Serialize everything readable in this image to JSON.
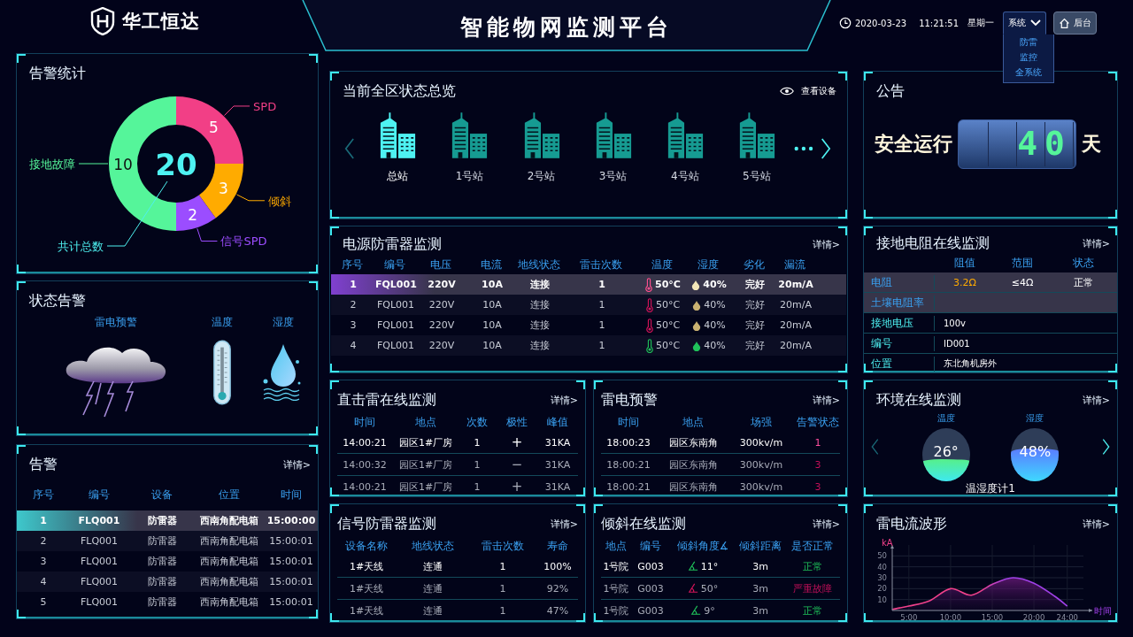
{
  "header": {
    "logo_text": "华工恒达",
    "title": "智能物网监测平台",
    "date": "2020-03-23",
    "time": "11:21:51",
    "weekday": "星期一",
    "system_menu": {
      "label": "系统",
      "expanded": true,
      "items": [
        "防雷",
        "监控",
        "全系统"
      ]
    },
    "back_button": "后台"
  },
  "alarm_stats": {
    "title": "告警统计",
    "total": "20",
    "total_label": "共计总数",
    "callouts": [
      {
        "color": "#f23f86"
      },
      {
        "color": "#ffab00"
      },
      {
        "color": "#9b4dff"
      },
      {
        "color": "#55f59a"
      }
    ],
    "chart_data": {
      "type": "donut",
      "categories": [
        "SPD",
        "倾斜",
        "信号SPD",
        "接地故障"
      ],
      "series": [
        {
          "values": [
            5,
            3,
            2,
            10
          ]
        }
      ],
      "data_labels": true
    }
  },
  "status_alarm": {
    "title": "状态告警",
    "items": [
      {
        "label": "雷电预警",
        "kind": "storm"
      },
      {
        "label": "温度",
        "kind": "thermometer"
      },
      {
        "label": "湿度",
        "kind": "droplet"
      }
    ]
  },
  "alarm_table": {
    "title": "告警",
    "more": "详情>",
    "columns": [
      "序号",
      "编号",
      "设备",
      "位置",
      "时间"
    ],
    "rows": [
      {
        "selected": true,
        "cells": [
          "1",
          "FLQ001",
          "防雷器",
          "西南角配电箱",
          "15:00:00"
        ]
      },
      {
        "selected": false,
        "cells": [
          "2",
          "FLQ001",
          "防雷器",
          "西南角配电箱",
          "15:00:01"
        ]
      },
      {
        "selected": false,
        "cells": [
          "3",
          "FLQ001",
          "防雷器",
          "西南角配电箱",
          "15:00:01"
        ]
      },
      {
        "selected": false,
        "cells": [
          "4",
          "FLQ001",
          "防雷器",
          "西南角配电箱",
          "15:00:01"
        ]
      },
      {
        "selected": false,
        "cells": [
          "5",
          "FLQ001",
          "防雷器",
          "西南角配电箱",
          "15:00:01"
        ]
      }
    ]
  },
  "overview": {
    "title": "当前全区状态总览",
    "view_button": "查看设备",
    "stations": [
      {
        "label": "总站",
        "selected": true
      },
      {
        "label": "1号站",
        "selected": false
      },
      {
        "label": "2号站",
        "selected": false
      },
      {
        "label": "3号站",
        "selected": false
      },
      {
        "label": "4号站",
        "selected": false
      },
      {
        "label": "5号站",
        "selected": false
      }
    ]
  },
  "power_spd": {
    "title": "电源防雷器监测",
    "more": "详情>",
    "columns": [
      "序号",
      "编号",
      "电压",
      "电流",
      "地线状态",
      "雷击次数",
      "温度",
      "湿度",
      "劣化",
      "漏流"
    ],
    "rows": [
      {
        "selected": true,
        "alert": true,
        "cells": [
          "1",
          "FQL001",
          "220V",
          "10A",
          "连接",
          "1",
          "50°C",
          "40%",
          "完好",
          "20m/A"
        ]
      },
      {
        "selected": false,
        "alert": true,
        "cells": [
          "2",
          "FQL001",
          "220V",
          "10A",
          "连接",
          "1",
          "50°C",
          "40%",
          "完好",
          "20m/A"
        ]
      },
      {
        "selected": false,
        "alert": true,
        "cells": [
          "3",
          "FQL001",
          "220V",
          "10A",
          "连接",
          "1",
          "50°C",
          "40%",
          "完好",
          "20m/A"
        ]
      },
      {
        "selected": false,
        "alert": false,
        "cells": [
          "4",
          "FQL001",
          "220V",
          "10A",
          "连接",
          "1",
          "50°C",
          "40%",
          "完好",
          "20m/A"
        ]
      }
    ]
  },
  "direct_strike": {
    "title": "直击雷在线监测",
    "more": "详情>",
    "columns": [
      "时间",
      "地点",
      "次数",
      "极性",
      "峰值"
    ],
    "rows": [
      {
        "selected": true,
        "cells": [
          "14:00:21",
          "园区1#厂房",
          "1",
          "+",
          "31KA"
        ]
      },
      {
        "selected": false,
        "cells": [
          "14:00:32",
          "园区1#厂房",
          "1",
          "−",
          "31KA"
        ]
      },
      {
        "selected": false,
        "cells": [
          "14:00:21",
          "园区1#厂房",
          "1",
          "+",
          "31KA"
        ]
      }
    ]
  },
  "lightning_warning": {
    "title": "雷电预警",
    "more": "详情>",
    "columns": [
      "时间",
      "地点",
      "场强",
      "告警状态"
    ],
    "rows": [
      {
        "selected": true,
        "cells": [
          "18:00:23",
          "园区东南角",
          "300kv/m",
          "1"
        ]
      },
      {
        "selected": false,
        "cells": [
          "18:00:21",
          "园区东南角",
          "300kv/m",
          "3"
        ]
      },
      {
        "selected": false,
        "cells": [
          "18:00:21",
          "园区东南角",
          "300kv/m",
          "3"
        ]
      }
    ]
  },
  "signal_spd": {
    "title": "信号防雷器监测",
    "more": "详情>",
    "columns": [
      "设备名称",
      "地线状态",
      "雷击次数",
      "寿命"
    ],
    "rows": [
      {
        "selected": true,
        "cells": [
          "1#天线",
          "连通",
          "1",
          "100%"
        ]
      },
      {
        "selected": false,
        "cells": [
          "1#天线",
          "连通",
          "1",
          "92%"
        ]
      },
      {
        "selected": false,
        "cells": [
          "1#天线",
          "连通",
          "1",
          "47%"
        ]
      }
    ]
  },
  "tilt": {
    "title": "倾斜在线监测",
    "more": "详情>",
    "columns": [
      "地点",
      "编号",
      "倾斜角度∡",
      "倾斜距离",
      "是否正常"
    ],
    "rows": [
      {
        "selected": true,
        "normal": true,
        "cells": [
          "1号院",
          "G003",
          "11°",
          "3m",
          "正常"
        ]
      },
      {
        "selected": false,
        "normal": false,
        "cells": [
          "1号院",
          "G003",
          "50°",
          "3m",
          "严重故障"
        ]
      },
      {
        "selected": false,
        "normal": true,
        "cells": [
          "1号院",
          "G003",
          "9°",
          "3m",
          "正常"
        ]
      }
    ]
  },
  "notice": {
    "title": "公告",
    "label": "安全运行",
    "days": "40",
    "unit": "天"
  },
  "ground_resistance": {
    "title": "接地电阻在线监测",
    "more": "详情>",
    "columns": [
      "阻值",
      "范围",
      "状态"
    ],
    "rows": [
      {
        "kind": "measure",
        "label": "电阻",
        "cells": [
          "3.2Ω",
          "≤4Ω",
          "正常"
        ]
      },
      {
        "kind": "measure",
        "label": "土壤电阻率",
        "cells": []
      },
      {
        "kind": "info",
        "label": "接地电压",
        "value": "100v"
      },
      {
        "kind": "info",
        "label": "编号",
        "value": "ID001"
      },
      {
        "kind": "info",
        "label": "位置",
        "value": "东北角机房外"
      }
    ]
  },
  "environment": {
    "title": "环境在线监测",
    "more": "详情>",
    "gauges": [
      {
        "kind": "temperature",
        "label": "温度",
        "value": "26°",
        "level": 0.42
      },
      {
        "kind": "humidity",
        "label": "湿度",
        "value": "48%",
        "level": 0.62
      }
    ],
    "device": "温湿度计1"
  },
  "waveform": {
    "title": "雷电流波形",
    "more": "详情>",
    "chart_data": {
      "type": "area",
      "xlabel": "时间",
      "ylabel": "kA",
      "x": [
        3,
        5,
        7.5,
        10,
        12.5,
        15,
        17.5,
        20,
        22.5,
        24
      ],
      "series": [
        {
          "color": "#f0408a",
          "values": [
            1,
            4,
            9,
            20,
            14,
            24,
            30,
            25,
            13,
            4
          ]
        }
      ],
      "xlim": [
        3,
        27
      ],
      "ylim": [
        0,
        60
      ],
      "grid": true,
      "xticks": [
        {
          "value": 5,
          "label": "5:00"
        },
        {
          "value": 10,
          "label": "10:00"
        },
        {
          "value": 15,
          "label": "15:00"
        },
        {
          "value": 20,
          "label": "20:00"
        },
        {
          "value": 24,
          "label": "24:00"
        }
      ],
      "yticks": [
        10,
        20,
        30,
        40,
        50
      ]
    }
  }
}
